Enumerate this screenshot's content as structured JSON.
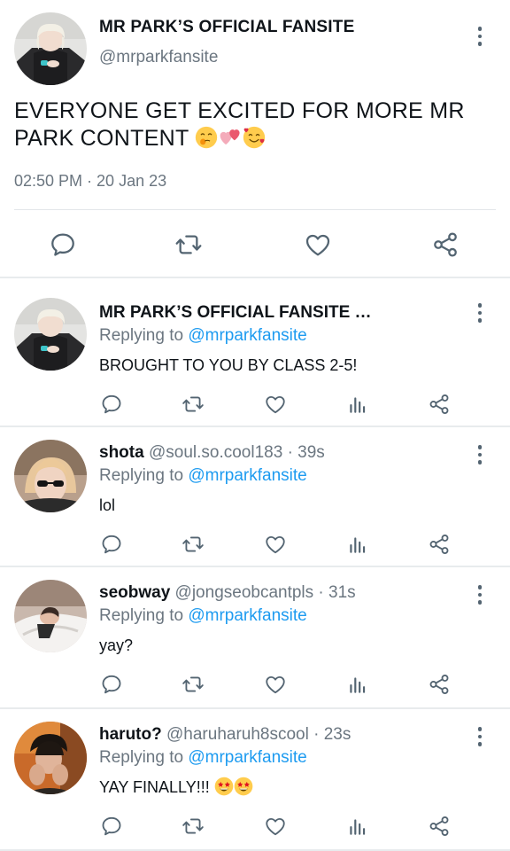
{
  "main_tweet": {
    "display_name": "MR PARK’S OFFICIAL FANSITE",
    "handle": "@mrparkfansite",
    "text": "EVERYONE GET EXCITED FOR MORE MR PARK CONTENT",
    "emojis": [
      "hand-over-mouth-emoji",
      "two-hearts-emoji",
      "smiling-face-with-hearts-emoji"
    ],
    "timestamp": "02:50 PM · 20 Jan 23",
    "actions": [
      "reply-icon",
      "retweet-icon",
      "like-icon",
      "share-icon"
    ]
  },
  "replies": [
    {
      "display_name": "MR PARK’S OFFICIAL FANSITE …",
      "handle": "",
      "time": "",
      "replying_label": "Replying to",
      "replying_to": "@mrparkfansite",
      "text": "BROUGHT TO YOU BY CLASS 2-5!",
      "emojis": []
    },
    {
      "display_name": "shota",
      "handle": "@soul.so.cool183 · 39s",
      "time": "",
      "replying_label": "Replying to",
      "replying_to": "@mrparkfansite",
      "text": "lol",
      "emojis": []
    },
    {
      "display_name": "seobway",
      "handle": "@jongseobcantpls · 31s",
      "time": "",
      "replying_label": "Replying to",
      "replying_to": "@mrparkfansite",
      "text": "yay?",
      "emojis": []
    },
    {
      "display_name": "haruto?",
      "handle": "@haruharuh8scool · 23s",
      "time": "",
      "replying_label": "Replying to",
      "replying_to": "@mrparkfansite",
      "text": "YAY FINALLY!!!",
      "emojis": [
        "star-struck-emoji",
        "star-struck-emoji"
      ]
    }
  ],
  "colors": {
    "link_blue": "#1d9bf0",
    "text_gray": "#6b7680",
    "icon_gray": "#536471",
    "divider": "#e3e7ea"
  }
}
